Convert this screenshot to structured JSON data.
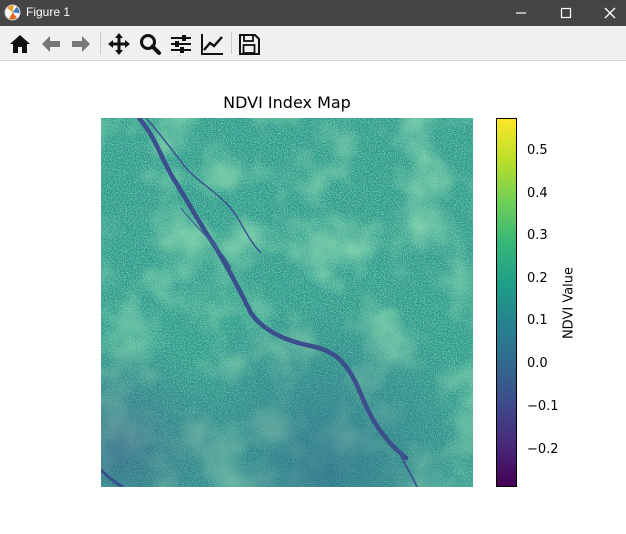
{
  "window": {
    "title": "Figure 1"
  },
  "toolbar": {
    "buttons": [
      {
        "name": "home",
        "icon": "home-icon"
      },
      {
        "name": "back",
        "icon": "arrow-left-icon"
      },
      {
        "name": "forward",
        "icon": "arrow-right-icon"
      },
      {
        "name": "pan",
        "icon": "move-icon"
      },
      {
        "name": "zoom",
        "icon": "magnifier-icon"
      },
      {
        "name": "configure-subplots",
        "icon": "sliders-icon"
      },
      {
        "name": "edit-axes",
        "icon": "line-chart-icon"
      },
      {
        "name": "save",
        "icon": "floppy-disk-icon"
      }
    ]
  },
  "chart_data": {
    "type": "heatmap",
    "title": "NDVI Index Map",
    "colorbar": {
      "label": "NDVI Value",
      "colormap": "viridis",
      "range": [
        -0.29,
        0.58
      ],
      "ticks": [
        0.5,
        0.4,
        0.3,
        0.2,
        0.1,
        0.0,
        -0.1,
        -0.2
      ],
      "tick_labels": [
        "0.5",
        "0.4",
        "0.3",
        "0.2",
        "0.1",
        "0.0",
        "−0.1",
        "−0.2"
      ]
    },
    "axes_visible": false,
    "colors": {
      "low": "#440154",
      "mid": "#21918c",
      "high": "#fde725"
    }
  }
}
